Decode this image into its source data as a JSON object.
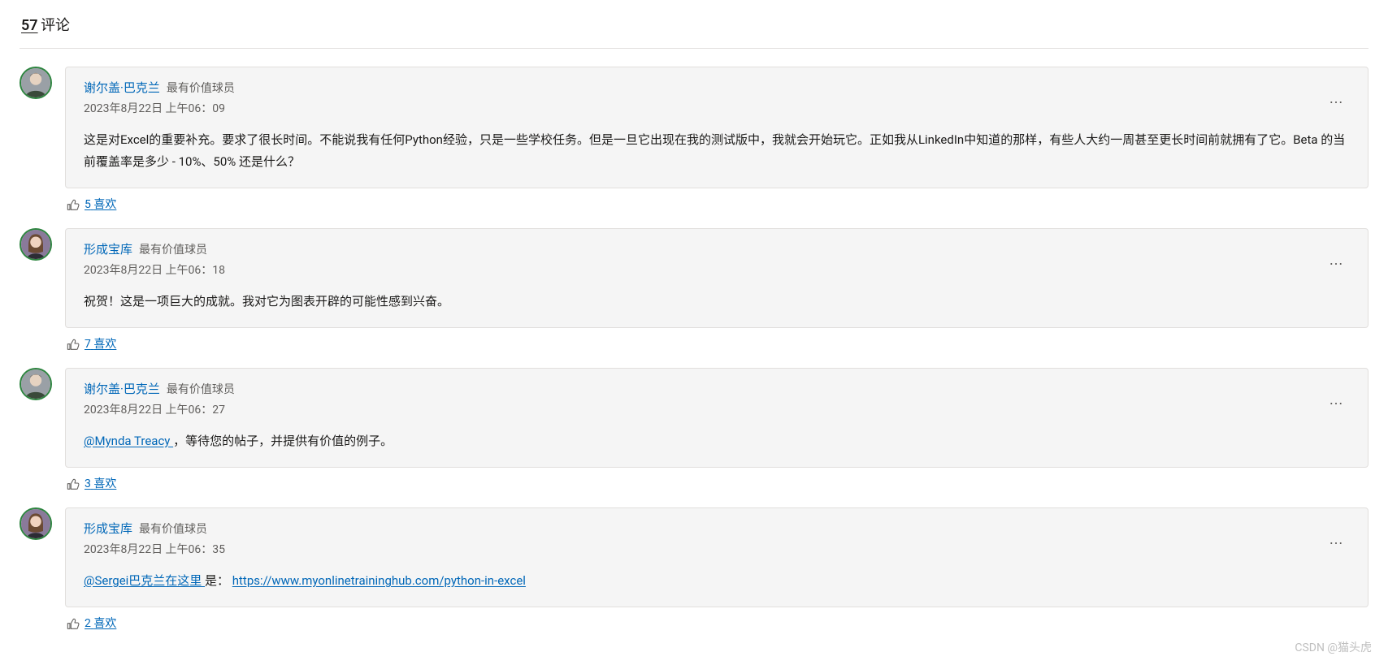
{
  "header": {
    "count": "57",
    "label": "评论"
  },
  "like_label": "喜欢",
  "comments": [
    {
      "author": "谢尔盖·巴克兰",
      "badge": "最有价值球员",
      "date": "2023年8月22日 上午06：09",
      "avatar": "male",
      "body_parts": [
        {
          "type": "text",
          "value": "这是对Excel的重要补充。要求了很长时间。不能说我有任何Python经验，只是一些学校任务。但是一旦它出现在我的测试版中，我就会开始玩它。正如我从LinkedIn中知道的那样，有些人大约一周甚至更长时间前就拥有了它。Beta 的当前覆盖率是多少 - 10%、50% 还是什么？"
        }
      ],
      "likes": "5"
    },
    {
      "author": "形成宝库",
      "badge": "最有价值球员",
      "date": "2023年8月22日 上午06：18",
      "avatar": "female",
      "body_parts": [
        {
          "type": "text",
          "value": "祝贺！这是一项巨大的成就。我对它为图表开辟的可能性感到兴奋。"
        }
      ],
      "likes": "7"
    },
    {
      "author": "谢尔盖·巴克兰",
      "badge": "最有价值球员",
      "date": "2023年8月22日 上午06：27",
      "avatar": "male",
      "body_parts": [
        {
          "type": "mention",
          "value": "@Mynda Treacy "
        },
        {
          "type": "text",
          "value": "，等待您的帖子，并提供有价值的例子。"
        }
      ],
      "likes": "3"
    },
    {
      "author": "形成宝库",
      "badge": "最有价值球员",
      "date": "2023年8月22日 上午06：35",
      "avatar": "female",
      "body_parts": [
        {
          "type": "mention",
          "value": "@Sergei巴克兰在这里 "
        },
        {
          "type": "text",
          "value": "是： "
        },
        {
          "type": "link",
          "value": "https://www.myonlinetraininghub.com/python-in-excel"
        }
      ],
      "likes": "2"
    }
  ],
  "watermark": "CSDN @猫头虎"
}
